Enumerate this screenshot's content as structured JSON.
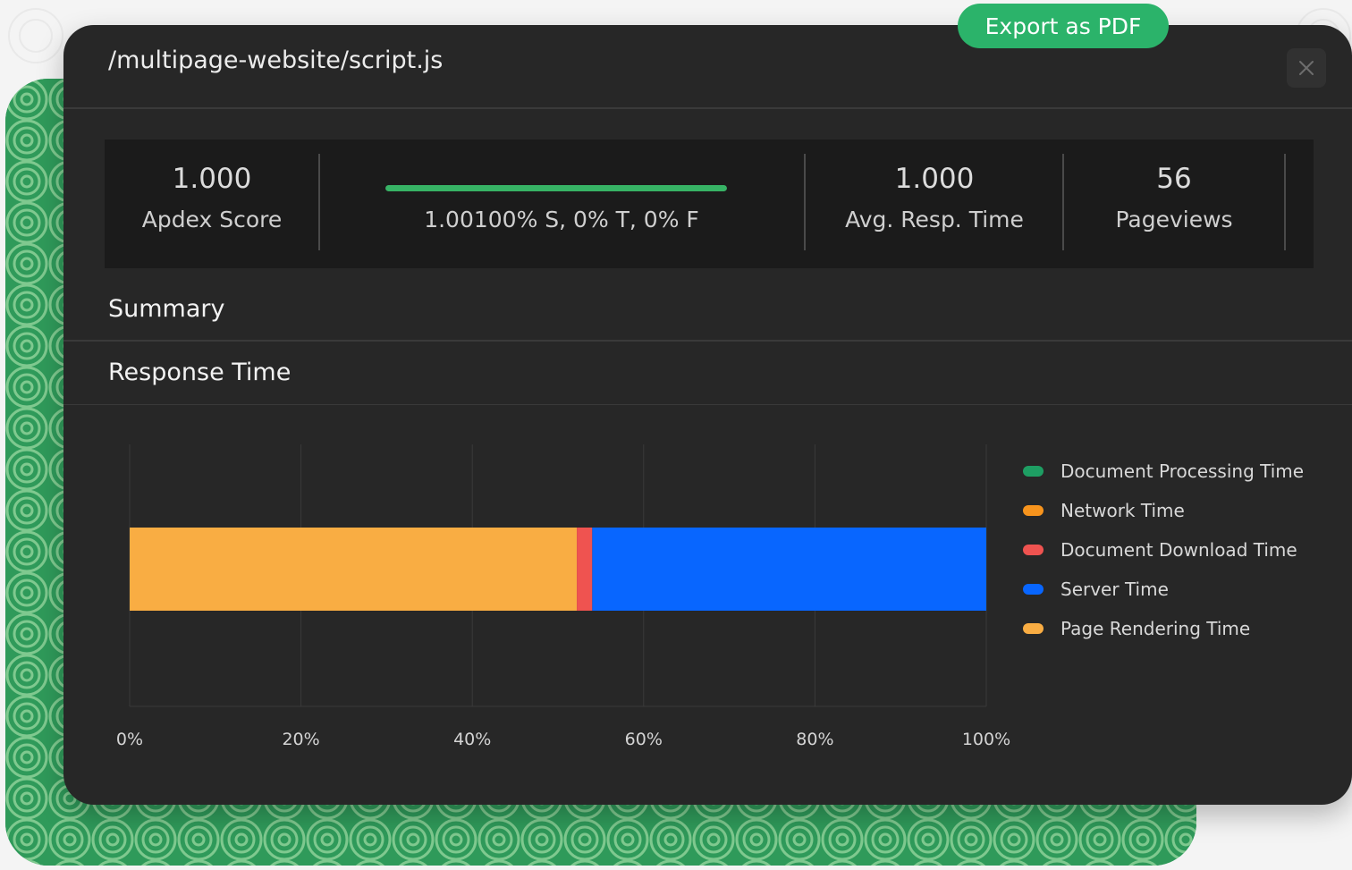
{
  "header": {
    "title": "/multipage-website/script.js",
    "export_label": "Export as PDF"
  },
  "stats": {
    "apdex_value": "1.000",
    "apdex_label": "Apdex Score",
    "apdex_breakdown": "1.00100% S, 0% T, 0% F",
    "apdex_satisfied_fraction": 1.0,
    "resp_value": "1.000",
    "resp_label": "Avg. Resp. Time",
    "pageviews_value": "56",
    "pageviews_label": "Pageviews"
  },
  "sections": {
    "summary": "Summary",
    "response_time": "Response Time"
  },
  "colors": {
    "accent_green": "#2bb36a",
    "panel_bg": "#272727"
  },
  "chart_data": {
    "type": "bar",
    "orientation": "horizontal",
    "stacked": true,
    "x_ticks": [
      "0%",
      "20%",
      "40%",
      "60%",
      "80%",
      "100%"
    ],
    "xlim": [
      0,
      100
    ],
    "grid": true,
    "legend_position": "right",
    "series": [
      {
        "name": "Document Processing Time",
        "value": 0,
        "color": "#1e9e63"
      },
      {
        "name": "Network Time",
        "value": 0,
        "color": "#f7941d"
      },
      {
        "name": "Page Rendering Time",
        "value": 52.2,
        "color": "#f9ad43"
      },
      {
        "name": "Document Download Time",
        "value": 1.8,
        "color": "#ef5350"
      },
      {
        "name": "Server Time",
        "value": 46.0,
        "color": "#0866ff"
      }
    ],
    "legend": [
      {
        "name": "Document Processing Time",
        "color": "#1e9e63"
      },
      {
        "name": "Network Time",
        "color": "#f7941d"
      },
      {
        "name": "Document Download Time",
        "color": "#ef5350"
      },
      {
        "name": "Server Time",
        "color": "#0866ff"
      },
      {
        "name": "Page Rendering Time",
        "color": "#f9ad43"
      }
    ]
  }
}
